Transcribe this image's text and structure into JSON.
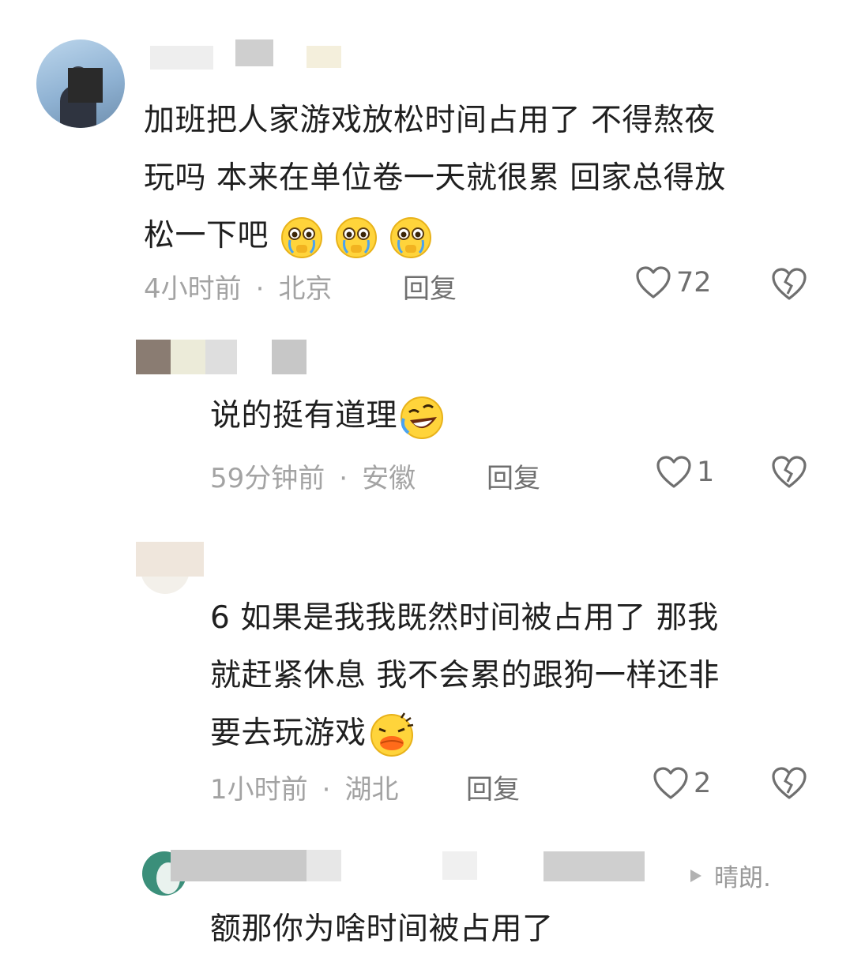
{
  "comments": [
    {
      "text_lines": [
        "加班把人家游戏放松时间占用了 不得熬夜",
        "玩吗 本来在单位卷一天就很累 回家总得放",
        "松一下吧"
      ],
      "emoji": "pleading-crying-emoji",
      "time": "4小时前",
      "location": "北京",
      "reply_label": "回复",
      "likes": "72"
    },
    {
      "text_lines": [
        "说的挺有道理"
      ],
      "emoji": "rolling-laughing-emoji",
      "time": "59分钟前",
      "location": "安徽",
      "reply_label": "回复",
      "likes": "1"
    },
    {
      "text_lines": [
        "6 如果是我我既然时间被占用了 那我",
        "就赶紧休息 我不会累的跟狗一样还非",
        "要去玩游戏"
      ],
      "emoji": "duck-lips-emoji",
      "time": "1小时前",
      "location": "湖北",
      "reply_label": "回复",
      "likes": "2"
    },
    {
      "text_lines": [
        "额那你为啥时间被占用了"
      ],
      "reply_to": "晴朗."
    }
  ],
  "separator": "·"
}
